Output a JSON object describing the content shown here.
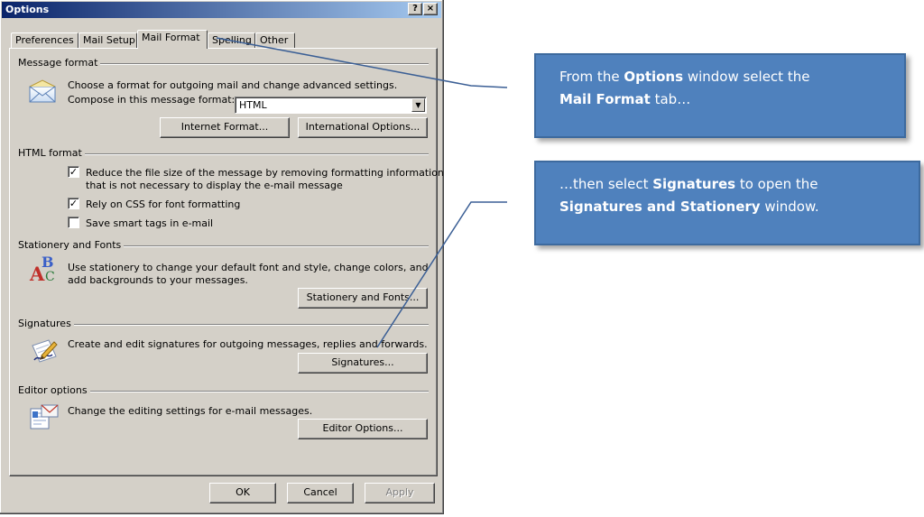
{
  "window": {
    "title": "Options",
    "help_glyph": "?",
    "close_glyph": "×"
  },
  "tabs": [
    {
      "label": "Preferences",
      "active": false
    },
    {
      "label": "Mail Setup",
      "active": false
    },
    {
      "label": "Mail Format",
      "active": true
    },
    {
      "label": "Spelling",
      "active": false
    },
    {
      "label": "Other",
      "active": false
    }
  ],
  "message_format": {
    "header": "Message format",
    "description": "Choose a format for outgoing mail and change advanced settings.",
    "compose_label": "Compose in this message format:",
    "compose_value": "HTML",
    "internet_format_button": "Internet Format...",
    "international_options_button": "International Options..."
  },
  "html_format": {
    "header": "HTML format",
    "options": [
      {
        "label_line1": "Reduce the file size of the message by removing formatting information",
        "label_line2": "that is not necessary to display the e-mail message",
        "checked": true
      },
      {
        "label_line1": "Rely on CSS for font formatting",
        "checked": true
      },
      {
        "label_line1": "Save smart tags in e-mail",
        "checked": false
      }
    ],
    "check_glyph": "✓"
  },
  "stationery": {
    "header": "Stationery and Fonts",
    "description_line1": "Use stationery to change your default font and style, change colors, and",
    "description_line2": "add backgrounds to your messages.",
    "button": "Stationery and Fonts...",
    "icon_glyph_1": "B",
    "icon_glyph_2": "A",
    "icon_glyph_3": "C"
  },
  "signatures": {
    "header": "Signatures",
    "description": "Create and edit signatures for outgoing messages, replies and forwards.",
    "button": "Signatures..."
  },
  "editor": {
    "header": "Editor options",
    "description": "Change the editing settings for e-mail messages.",
    "button": "Editor Options..."
  },
  "footer": {
    "ok": "OK",
    "cancel": "Cancel",
    "apply": "Apply",
    "apply_enabled": false
  },
  "callouts": [
    {
      "line1_pre": "From the ",
      "line1_bold": "Options",
      "line1_post": " window select the",
      "line2_bold": "Mail Format",
      "line2_post": " tab…"
    },
    {
      "line1_pre": "…then select ",
      "line1_bold": "Signatures",
      "line1_post": " to open the",
      "line2_bold": "Signatures and Stationery",
      "line2_post": " window."
    }
  ],
  "colors": {
    "dialog_face": "#d4d0c8",
    "titlebar_start": "#0a246a",
    "titlebar_end": "#a6caf0",
    "callout_fill": "#4f81bd",
    "pointer_line": "#3b5f95"
  }
}
